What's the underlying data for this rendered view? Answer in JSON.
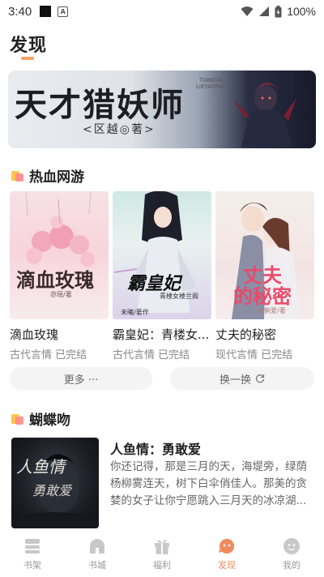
{
  "status_bar": {
    "time": "3:40",
    "battery": "100%"
  },
  "page": {
    "title": "发现"
  },
  "banner": {
    "title": "天才猎妖师",
    "author": "<区越◎著>",
    "subtitle_line1": "TIANCAI",
    "subtitle_line2": "LIEYAOSHI"
  },
  "section1": {
    "title": "热血网游",
    "books": [
      {
        "title": "滴血玫瑰",
        "category": "古代言情",
        "status": "已完结",
        "cover_text": "滴血玫瑰",
        "cover_author": "亦瑶/著"
      },
      {
        "title": "霸皇妃：青楼女...",
        "category": "古代言情",
        "status": "已完结",
        "cover_text": "霸皇妃",
        "cover_author": "未曦/著作",
        "cover_sub": "青楼女楼兰阁"
      },
      {
        "title": "丈夫的秘密",
        "category": "现代言情",
        "status": "已完结",
        "cover_text_1": "丈夫",
        "cover_text_2": "的秘密",
        "cover_author": "伶俐爱/著"
      }
    ],
    "more_label": "更多 ···",
    "refresh_label": "换一换"
  },
  "section2": {
    "title": "蝴蝶吻",
    "feature": {
      "title": "人鱼情：勇敢爱",
      "description": "你还记得，那是三月的天，海堤旁，绿荫杨柳雾连天，树下白伞俏佳人。那美的贪婪的女子让你宁愿跳入三月天的冰凉湖...",
      "cover_text_1": "人鱼情",
      "cover_text_2": "勇敢爱"
    }
  },
  "bottom_nav": {
    "items": [
      {
        "label": "书架",
        "icon": "bookshelf-icon"
      },
      {
        "label": "书城",
        "icon": "bookstore-icon"
      },
      {
        "label": "福利",
        "icon": "gift-icon"
      },
      {
        "label": "发现",
        "icon": "discover-icon",
        "active": true
      },
      {
        "label": "我的",
        "icon": "profile-icon"
      }
    ]
  },
  "colors": {
    "accent": "#f08a5d",
    "inactive": "#bbbbbb"
  }
}
